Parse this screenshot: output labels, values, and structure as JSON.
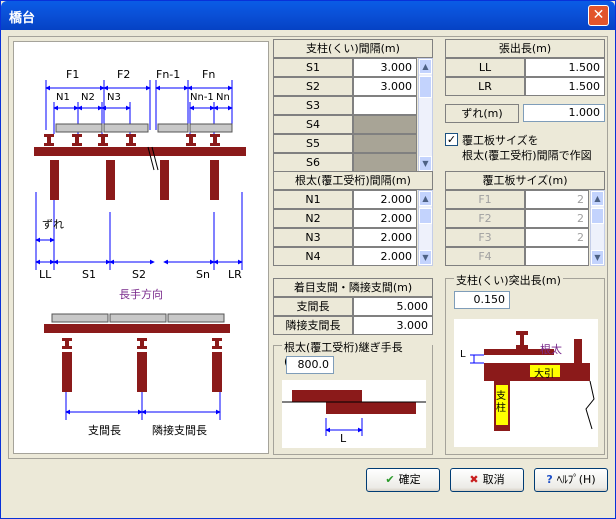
{
  "window": {
    "title": "橋台"
  },
  "diagram": {
    "top_labels": [
      "F1",
      "F2",
      "Fn-1",
      "Fn",
      "N1",
      "N2",
      "N3",
      "Nn-1",
      "Nn",
      "ずれ",
      "LL",
      "S1",
      "S2",
      "Sn",
      "LR"
    ],
    "bottom_title": "長手方向",
    "bottom_labels": [
      "支間長",
      "隣接支間長"
    ]
  },
  "column_spacing": {
    "header": "支柱(くい)間隔(m)",
    "rows": [
      {
        "label": "S1",
        "value": "3.000"
      },
      {
        "label": "S2",
        "value": "3.000"
      },
      {
        "label": "S3",
        "value": ""
      },
      {
        "label": "S4",
        "value": ""
      },
      {
        "label": "S5",
        "value": ""
      },
      {
        "label": "S6",
        "value": ""
      }
    ]
  },
  "overhang": {
    "header": "張出長(m)",
    "rows": [
      {
        "label": "LL",
        "value": "1.500"
      },
      {
        "label": "LR",
        "value": "1.500"
      }
    ]
  },
  "offset": {
    "label": "ずれ(m)",
    "value": "1.000"
  },
  "checkbox": {
    "checked": true,
    "line1": "覆工板サイズを",
    "line2": "根太(覆工受桁)間隔で作図"
  },
  "joist_spacing": {
    "header": "根太(覆工受桁)間隔(m)",
    "rows": [
      {
        "label": "N1",
        "value": "2.000"
      },
      {
        "label": "N2",
        "value": "2.000"
      },
      {
        "label": "N3",
        "value": "2.000"
      },
      {
        "label": "N4",
        "value": "2.000"
      }
    ]
  },
  "plate_size": {
    "header": "覆工板サイズ(m)",
    "rows": [
      {
        "label": "F1",
        "value": "2"
      },
      {
        "label": "F2",
        "value": "2"
      },
      {
        "label": "F3",
        "value": "2"
      },
      {
        "label": "F4",
        "value": ""
      }
    ]
  },
  "span": {
    "header": "着目支間・隣接支間(m)",
    "rows": [
      {
        "label": "支間長",
        "value": "5.000"
      },
      {
        "label": "隣接支間長",
        "value": "3.000"
      }
    ]
  },
  "joint": {
    "title": "根太(覆工受桁)継ぎ手長(mm)",
    "value": "800.0",
    "label": "L"
  },
  "protrusion": {
    "title": "支柱(くい)突出長(m)",
    "value": "0.150",
    "labels": [
      "根太",
      "大引",
      "支柱",
      "L"
    ]
  },
  "buttons": {
    "ok": "確定",
    "cancel": "取消",
    "help": "ﾍﾙﾌﾟ(H)"
  },
  "colors": {
    "member": "#8b1a1a",
    "beam_label_bg": "#ffff00",
    "dim_line": "#0000ff",
    "title": "#7a2a8c"
  }
}
